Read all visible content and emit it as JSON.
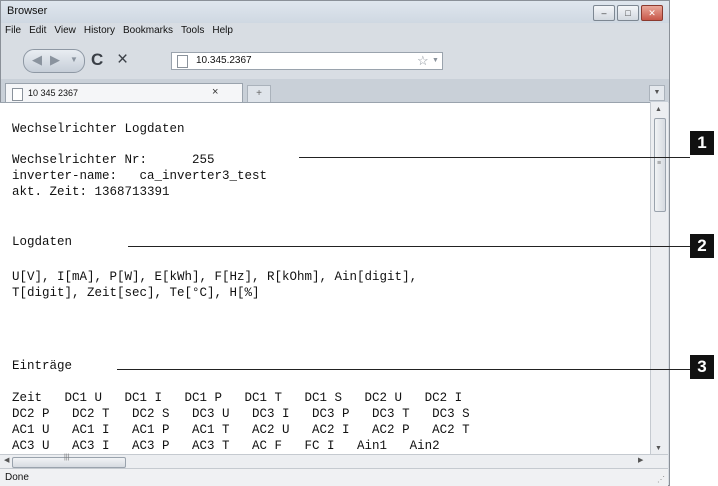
{
  "window": {
    "title": "Browser",
    "controls": {
      "minimize": "–",
      "maximize": "□",
      "close": "✕"
    }
  },
  "menu": {
    "file": "File",
    "edit": "Edit",
    "view": "View",
    "history": "History",
    "bookmarks": "Bookmarks",
    "tools": "Tools",
    "help": "Help"
  },
  "nav": {
    "url": "10.345.2367",
    "back_icon": "arrow-left-icon",
    "forward_icon": "arrow-right-icon",
    "reload_glyph": "C",
    "stop_glyph": "×",
    "star_glyph": "☆"
  },
  "tab": {
    "title": "10 345 2367",
    "close": "×",
    "new_tab": "+"
  },
  "content": {
    "heading": "Wechselrichter Logdaten",
    "inverter_nr": "Wechselrichter Nr:      255",
    "inverter_name": "inverter-name:   ca_inverter3_test",
    "time": "akt. Zeit: 1368713391",
    "logdata_heading": "Logdaten",
    "units_line1": "U[V], I[mA], P[W], E[kWh], F[Hz], R[kOhm], Ain[digit],",
    "units_line2": "T[digit], Zeit[sec], Te[°C], H[%]",
    "entries_heading": "Einträge",
    "entries": [
      "Zeit   DC1 U   DC1 I   DC1 P   DC1 T   DC1 S   DC2 U   DC2 I",
      "DC2 P   DC2 T   DC2 S   DC3 U   DC3 I   DC3 P   DC3 T   DC3 S",
      "AC1 U   AC1 I   AC1 P   AC1 T   AC2 U   AC2 I   AC2 P   AC2 T",
      "AC3 U   AC3 I   AC3 P   AC3 T   AC F   FC I   Ain1   Ain2"
    ]
  },
  "status": {
    "text": "Done"
  },
  "callouts": [
    "1",
    "2",
    "3"
  ]
}
